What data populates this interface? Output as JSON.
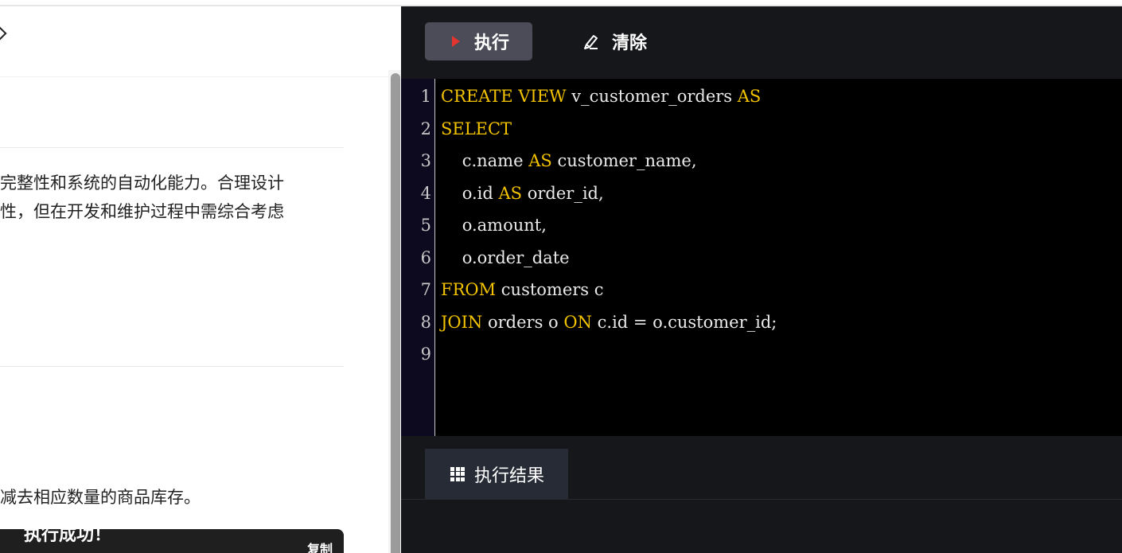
{
  "toolbar": {
    "run_label": "执行",
    "clear_label": "清除"
  },
  "editor": {
    "lines": [
      {
        "n": "1",
        "parts": [
          {
            "t": "CREATE VIEW",
            "k": true
          },
          {
            "t": " v_customer_orders ",
            "k": false
          },
          {
            "t": "AS",
            "k": true
          }
        ]
      },
      {
        "n": "2",
        "parts": [
          {
            "t": "SELECT",
            "k": true
          }
        ]
      },
      {
        "n": "3",
        "parts": [
          {
            "t": "    c.name ",
            "k": false
          },
          {
            "t": "AS",
            "k": true
          },
          {
            "t": " customer_name,",
            "k": false
          }
        ]
      },
      {
        "n": "4",
        "parts": [
          {
            "t": "    o.id ",
            "k": false
          },
          {
            "t": "AS",
            "k": true
          },
          {
            "t": " order_id,",
            "k": false
          }
        ]
      },
      {
        "n": "5",
        "parts": [
          {
            "t": "    o.amount,",
            "k": false
          }
        ]
      },
      {
        "n": "6",
        "parts": [
          {
            "t": "    o.order_date",
            "k": false
          }
        ]
      },
      {
        "n": "7",
        "parts": [
          {
            "t": "FROM",
            "k": true
          },
          {
            "t": " customers c",
            "k": false
          }
        ]
      },
      {
        "n": "8",
        "parts": [
          {
            "t": "JOIN",
            "k": true
          },
          {
            "t": " orders o ",
            "k": false
          },
          {
            "t": "ON",
            "k": true
          },
          {
            "t": " c.id = o.customer_id;",
            "k": false
          }
        ]
      },
      {
        "n": "9",
        "parts": []
      }
    ]
  },
  "left": {
    "para1_line1": "完整性和系统的自动化能力。合理设计",
    "para1_line2": "性，但在开发和维护过程中需综合考虑",
    "para2_line1": "减去相应数量的商品库存。",
    "copy_label": "复制"
  },
  "results": {
    "tab_label": "执行结果",
    "status": "执行成功！"
  },
  "colors": {
    "keyword": "#f2c200",
    "run_icon": "#e3342f"
  }
}
